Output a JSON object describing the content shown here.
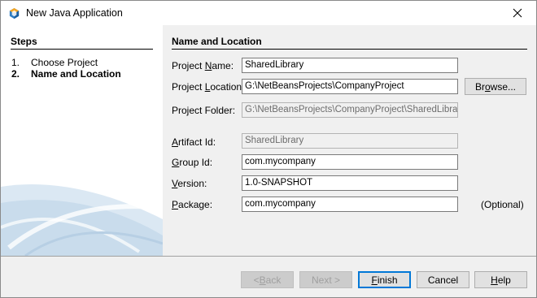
{
  "window": {
    "title": "New Java Application"
  },
  "steps": {
    "title": "Steps",
    "items": [
      {
        "num": "1.",
        "label": "Choose Project"
      },
      {
        "num": "2.",
        "label": "Name and Location"
      }
    ]
  },
  "section": {
    "title": "Name and Location"
  },
  "form": {
    "project_name": {
      "label_pre": "Project ",
      "label_key": "N",
      "label_post": "ame:",
      "value": "SharedLibrary"
    },
    "project_location": {
      "label_pre": "Project ",
      "label_key": "L",
      "label_post": "ocation:",
      "value": "G:\\NetBeansProjects\\CompanyProject"
    },
    "project_folder": {
      "label": "Project Folder:",
      "value": "G:\\NetBeansProjects\\CompanyProject\\SharedLibrary"
    },
    "artifact_id": {
      "label_pre": "",
      "label_key": "A",
      "label_post": "rtifact Id:",
      "value": "SharedLibrary"
    },
    "group_id": {
      "label_pre": "",
      "label_key": "G",
      "label_post": "roup Id:",
      "value": "com.mycompany"
    },
    "version": {
      "label_pre": "",
      "label_key": "V",
      "label_post": "ersion:",
      "value": "1.0-SNAPSHOT"
    },
    "package": {
      "label_pre": "",
      "label_key": "P",
      "label_post": "ackage:",
      "value": "com.mycompany",
      "hint": "(Optional)"
    }
  },
  "buttons": {
    "browse": {
      "pre": "Br",
      "key": "o",
      "post": "wse..."
    },
    "back": {
      "pre": "< ",
      "key": "B",
      "post": "ack"
    },
    "next": {
      "label": "Next >"
    },
    "finish": {
      "pre": "",
      "key": "F",
      "post": "inish"
    },
    "cancel": {
      "label": "Cancel"
    },
    "help": {
      "pre": "",
      "key": "H",
      "post": "elp"
    }
  }
}
